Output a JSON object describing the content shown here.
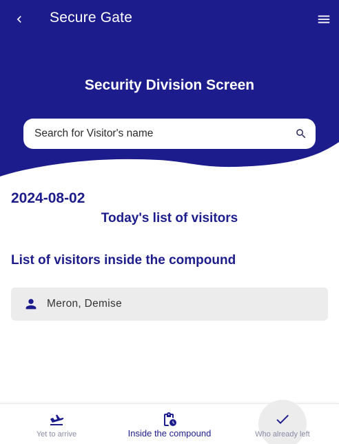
{
  "app": {
    "title": "Secure Gate"
  },
  "header": {
    "screen_title": "Security Division Screen",
    "back_icon": "chevron-left-icon",
    "menu_icon": "hamburger-menu-icon"
  },
  "search": {
    "placeholder": "Search for Visitor's name",
    "value": "",
    "icon": "search-icon"
  },
  "main": {
    "date": "2024-08-02",
    "subtitle": "Today's list of visitors",
    "section_title": "List of visitors inside the compound",
    "visitors": [
      {
        "name": "Meron, Demise",
        "icon": "person-icon"
      }
    ]
  },
  "bottom_nav": {
    "items": [
      {
        "label": "Yet to arrive",
        "icon": "landing-icon",
        "active": false
      },
      {
        "label": "Inside the compound",
        "icon": "clipboard-clock-icon",
        "active": true
      },
      {
        "label": "Who already left",
        "icon": "check-icon",
        "active": false
      }
    ]
  },
  "colors": {
    "primary": "#1c1c8c",
    "header_bg": "#1c1c8c",
    "card_bg": "#ececec",
    "inactive_nav": "#8a8aa6"
  }
}
